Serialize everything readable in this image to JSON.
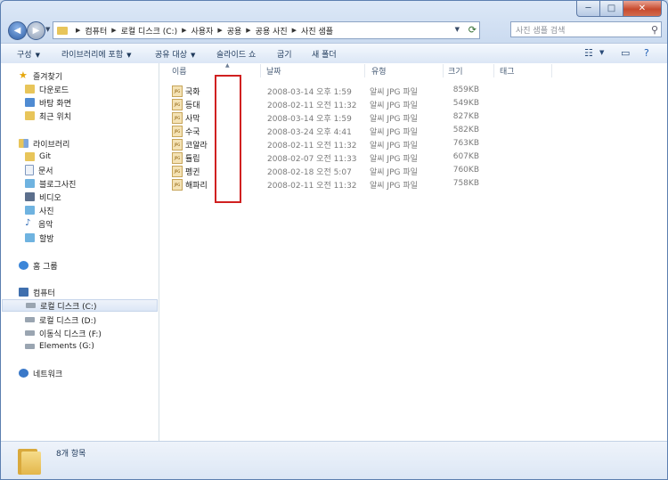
{
  "window": {
    "caption": {
      "minimize": "─",
      "maximize": "□",
      "close": "✕"
    }
  },
  "address_bar": {
    "breadcrumbs": [
      "컴퓨터",
      "로컬 디스크 (C:)",
      "사용자",
      "공용",
      "공용 사진",
      "사진 샘플"
    ]
  },
  "search": {
    "placeholder": "사진 샘플 검색"
  },
  "toolbar": {
    "organize": "구성",
    "include_library": "라이브러리에 포함",
    "share_with": "공유 대상",
    "slideshow": "슬라이드 쇼",
    "burn": "굽기",
    "new_folder": "새 폴더"
  },
  "nav": {
    "favorites": {
      "label": "즐겨찾기",
      "items": [
        "다운로드",
        "바탕 화면",
        "최근 위치"
      ]
    },
    "libraries": {
      "label": "라이브러리",
      "items": [
        "Git",
        "문서",
        "블로그사진",
        "비디오",
        "사진",
        "음악",
        "할방"
      ]
    },
    "homegroup": {
      "label": "홈 그룹"
    },
    "computer": {
      "label": "컴퓨터",
      "items": [
        "로컬 디스크 (C:)",
        "로컬 디스크 (D:)",
        "이동식 디스크 (F:)",
        "Elements (G:)"
      ],
      "selected": "로컬 디스크 (C:)"
    },
    "network": {
      "label": "네트워크"
    }
  },
  "columns": {
    "name": "이름",
    "date": "날짜",
    "type": "유형",
    "size": "크기",
    "tags": "태그"
  },
  "files": [
    {
      "name": "국화",
      "date": "2008-03-14 오후 1:59",
      "type": "알씨 JPG 파일",
      "size": "859KB"
    },
    {
      "name": "등대",
      "date": "2008-02-11 오전 11:32",
      "type": "알씨 JPG 파일",
      "size": "549KB"
    },
    {
      "name": "사막",
      "date": "2008-03-14 오후 1:59",
      "type": "알씨 JPG 파일",
      "size": "827KB"
    },
    {
      "name": "수국",
      "date": "2008-03-24 오후 4:41",
      "type": "알씨 JPG 파일",
      "size": "582KB"
    },
    {
      "name": "코알라",
      "date": "2008-02-11 오전 11:32",
      "type": "알씨 JPG 파일",
      "size": "763KB"
    },
    {
      "name": "튤립",
      "date": "2008-02-07 오전 11:33",
      "type": "알씨 JPG 파일",
      "size": "607KB"
    },
    {
      "name": "펭귄",
      "date": "2008-02-18 오전 5:07",
      "type": "알씨 JPG 파일",
      "size": "760KB"
    },
    {
      "name": "해파리",
      "date": "2008-02-11 오전 11:32",
      "type": "알씨 JPG 파일",
      "size": "758KB"
    }
  ],
  "file_icon_label": "JPG",
  "details": {
    "item_count": "8개 항목"
  }
}
